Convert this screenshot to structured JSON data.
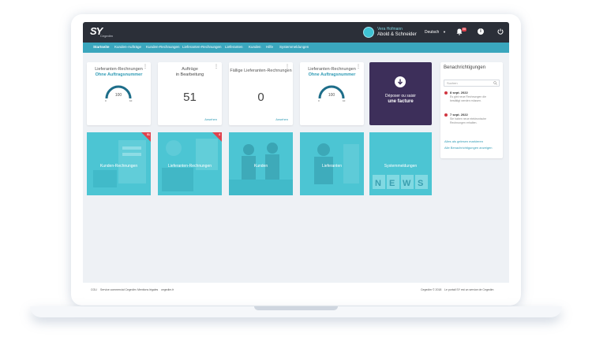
{
  "header": {
    "logo": "SY",
    "logo_sub": "Cegedim",
    "user_name": "Vera Hofmann",
    "user_company": "Abold & Schneider",
    "language": "Deutsch",
    "bell_badge": "58",
    "icons": {
      "bell": "bell-icon",
      "info": "info-icon",
      "power": "power-icon"
    }
  },
  "nav": [
    "Startseite",
    "Kunden-Aufträge",
    "Kunden-Rechnungen",
    "Lieferanten-Rechnungen",
    "Lieferanten",
    "Kunden",
    "Hilfe",
    "Systemmeldungen"
  ],
  "cards": {
    "card1": {
      "title": "Lieferanten-Rechnungen",
      "subtitle": "Ohne Auftragsnummer",
      "gauge_value": "100",
      "gauge_min": "0",
      "gauge_max": "10"
    },
    "card2": {
      "title": "Aufträge",
      "subtitle": "in Bearbeitung",
      "value": "51",
      "link": "Ansehen"
    },
    "card3": {
      "title": "Fällige Lieferanten-Rechnungen",
      "value": "0",
      "link": "Ansehen"
    },
    "card4": {
      "title": "Lieferanten-Rechnungen",
      "subtitle": "Ohne Auftragsnummer",
      "gauge_value": "100",
      "gauge_min": "0",
      "gauge_max": "10"
    },
    "upload": {
      "line1": "Déposer ou saisir",
      "line2": "une facture",
      "icon": "cloud-download-icon"
    }
  },
  "tiles": [
    {
      "label": "Kunden-Rechnungen",
      "badge": "51"
    },
    {
      "label": "Lieferanten-Rechnungen",
      "badge": "4"
    },
    {
      "label": "Kunden",
      "badge": ""
    },
    {
      "label": "Lieferanten",
      "badge": ""
    },
    {
      "label": "Systemmeldungen",
      "badge": ""
    }
  ],
  "notifications": {
    "title": "Benachrichtigungen",
    "search_placeholder": "Suchen",
    "items": [
      {
        "date": "8 sept. 2022",
        "text": "Es gibt neue Rechnungen die bestätigt werden müssen."
      },
      {
        "date": "7 sept. 2022",
        "text": "Sie haben neue elektronische Rechnungen erhalten."
      }
    ],
    "mark_all": "Alles als gelesen markieren",
    "show_all": "Alle Benachrichtigungen anzeigen"
  },
  "footer": {
    "links": [
      "CGU",
      "Service commercial Cegedim",
      "Mentions légales",
      "cegedim.fr"
    ],
    "copyright": "Cegedim © 2018",
    "right_text": "Le portail SY est un service de Cegedim"
  },
  "colors": {
    "topbar": "#2b2f38",
    "nav": "#3aa6bd",
    "accent": "#2f9bb5",
    "upload": "#3d2f5a",
    "tile": "#47c2d1",
    "badge": "#e0424d"
  }
}
